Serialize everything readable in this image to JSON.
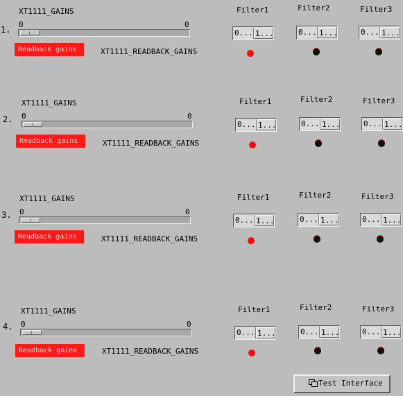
{
  "rows": [
    {
      "index": "1.",
      "gains_label": "XT1111_GAINS",
      "slider_min": "0",
      "slider_max": "0",
      "readback_button": "Readback gains",
      "readback_name": "XT1111_READBACK_GAINS",
      "filters": [
        {
          "label": "Filter1",
          "left": "0...",
          "right": "1...",
          "status": "red"
        },
        {
          "label": "Filter2",
          "left": "0...",
          "right": "1...",
          "status": "black"
        },
        {
          "label": "Filter3",
          "left": "0...",
          "right": "1...",
          "status": "black"
        }
      ]
    },
    {
      "index": "2.",
      "gains_label": "XT1111_GAINS",
      "slider_min": "0",
      "slider_max": "0",
      "readback_button": "Readback gains",
      "readback_name": "XT1111_READBACK_GAINS",
      "filters": [
        {
          "label": "Filter1",
          "left": "0...",
          "right": "1...",
          "status": "red"
        },
        {
          "label": "Filter2",
          "left": "0...",
          "right": "1...",
          "status": "black"
        },
        {
          "label": "Filter3",
          "left": "0...",
          "right": "1...",
          "status": "black"
        }
      ]
    },
    {
      "index": "3.",
      "gains_label": "XT1111_GAINS",
      "slider_min": "0",
      "slider_max": "0",
      "readback_button": "Readback gains",
      "readback_name": "XT1111_READBACK_GAINS",
      "filters": [
        {
          "label": "Filter1",
          "left": "0...",
          "right": "1...",
          "status": "red"
        },
        {
          "label": "Filter2",
          "left": "0...",
          "right": "1...",
          "status": "black"
        },
        {
          "label": "Filter3",
          "left": "0...",
          "right": "1...",
          "status": "black"
        }
      ]
    },
    {
      "index": "4.",
      "gains_label": "XT1111_GAINS",
      "slider_min": "0",
      "slider_max": "0",
      "readback_button": "Readback gains",
      "readback_name": "XT1111_READBACK_GAINS",
      "filters": [
        {
          "label": "Filter1",
          "left": "0...",
          "right": "1...",
          "status": "red"
        },
        {
          "label": "Filter2",
          "left": "0...",
          "right": "1...",
          "status": "black"
        },
        {
          "label": "Filter3",
          "left": "0...",
          "right": "1...",
          "status": "black"
        }
      ]
    }
  ],
  "test_button": {
    "label": "Test Interface",
    "icon": "window-icon"
  },
  "colors": {
    "background": "#bcbcbc",
    "readback": "#ff1a1a",
    "led_on": "#ee1010",
    "led_off": "#111111"
  }
}
